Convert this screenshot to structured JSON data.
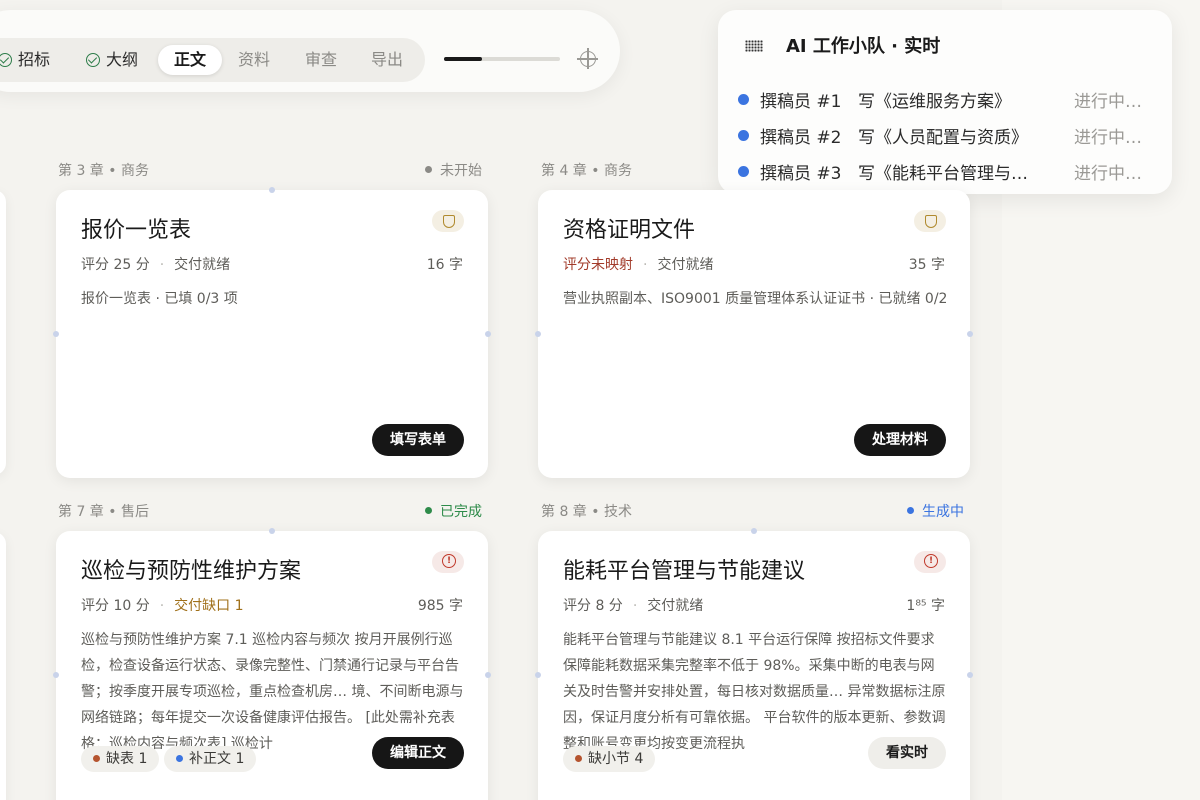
{
  "steps": [
    {
      "label": "招标",
      "done": true
    },
    {
      "label": "大纲",
      "done": true
    },
    {
      "label": "正文",
      "active": true
    },
    {
      "label": "资料"
    },
    {
      "label": "审查"
    },
    {
      "label": "导出"
    }
  ],
  "progress_fraction": 0.33,
  "ai_panel": {
    "title": "AI 工作小队 · 实时",
    "rows": [
      {
        "who": "撰稿员 #1",
        "what": "写《运维服务方案》",
        "status": "进行中…"
      },
      {
        "who": "撰稿员 #2",
        "what": "写《人员配置与资质》",
        "status": "进行中…"
      },
      {
        "who": "撰稿员 #3",
        "what": "写《能耗平台管理与…",
        "status": "进行中…"
      }
    ]
  },
  "cards": [
    {
      "chapter": "第 3 章 • 商务",
      "status": "未开始",
      "status_color": "#8b8a86",
      "title": "报价一览表",
      "score": "评分 25 分",
      "delivery": "交付就绪",
      "words": "16 字",
      "desc": "报价一览表 · 已填 0/3 项",
      "action": "填写表单",
      "icon": "shield-icon"
    },
    {
      "chapter": "第 4 章 • 商务",
      "status": "",
      "title": "资格证明文件",
      "score": "评分未映射",
      "delivery": "交付就绪",
      "words": "35 字",
      "desc": "营业执照副本、ISO9001 质量管理体系认证证书 · 已就绪 0/2",
      "action": "处理材料",
      "icon": "shield-icon"
    },
    {
      "chapter": "第 7 章 • 售后",
      "status": "已完成",
      "status_color": "#2e8b4a",
      "title": "巡检与预防性维护方案",
      "score": "评分 10 分",
      "delivery": "交付缺口 1",
      "words": "985 字",
      "desc": "巡检与预防性维护方案 7.1 巡检内容与频次 按月开展例行巡检，检查设备运行状态、录像完整性、门禁通行记录与平台告警；按季度开展专项巡检，重点检查机房… 境、不间断电源与网络链路；每年提交一次设备健康评估报告。 [此处需补充表格：巡检内容与频次表] 巡检计",
      "tags": [
        {
          "label": "缺表 1",
          "color": "#b5542f"
        },
        {
          "label": "补正文 1",
          "color": "#3b74e0"
        }
      ],
      "action": "编辑正文",
      "icon": "alert-icon"
    },
    {
      "chapter": "第 8 章 • 技术",
      "status": "生成中",
      "status_color": "#3b74e0",
      "title": "能耗平台管理与节能建议",
      "score": "评分 8 分",
      "delivery": "交付就绪",
      "words": "1⁸⁵ 字",
      "desc": "能耗平台管理与节能建议 8.1 平台运行保障 按招标文件要求保障能耗数据采集完整率不低于 98%。采集中断的电表与网关及时告警并安排处置，每日核对数据质量… 异常数据标注原因，保证月度分析有可靠依据。 平台软件的版本更新、参数调整和账号变更均按变更流程执",
      "tags": [
        {
          "label": "缺小节 4",
          "color": "#b5542f"
        }
      ],
      "action": "看实时",
      "icon": "alert-icon"
    }
  ]
}
